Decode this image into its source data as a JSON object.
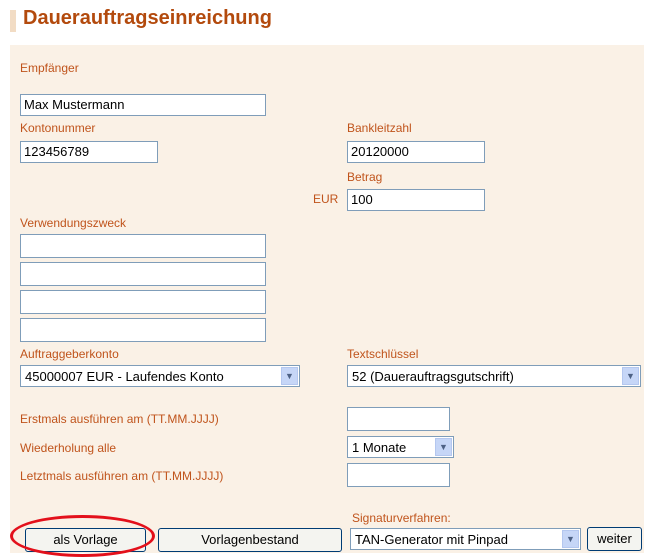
{
  "page": {
    "title": "Dauerauftragseinreichung"
  },
  "form": {
    "empfaenger": {
      "label": "Empfänger",
      "value": "Max Mustermann"
    },
    "kontonummer": {
      "label": "Kontonummer",
      "value": "123456789"
    },
    "bankleitzahl": {
      "label": "Bankleitzahl",
      "value": "20120000"
    },
    "betrag": {
      "label": "Betrag",
      "currency": "EUR",
      "value": "100"
    },
    "verwendungszweck": {
      "label": "Verwendungszweck",
      "lines": [
        "",
        "",
        "",
        ""
      ]
    },
    "auftraggeberkonto": {
      "label": "Auftraggeberkonto",
      "selected": "45000007 EUR - Laufendes Konto"
    },
    "textschluessel": {
      "label": "Textschlüssel",
      "selected": "52 (Dauerauftragsgutschrift)"
    },
    "erstmals": {
      "label": "Erstmals ausführen am (TT.MM.JJJJ)",
      "value": ""
    },
    "wiederholung": {
      "label": "Wiederholung alle",
      "selected": "1 Monate"
    },
    "letztmals": {
      "label": "Letztmals ausführen am (TT.MM.JJJJ)",
      "value": ""
    },
    "signaturverfahren": {
      "label": "Signaturverfahren:",
      "selected": "TAN-Generator mit Pinpad"
    }
  },
  "buttons": {
    "als_vorlage": "als Vorlage",
    "vorlagenbestand": "Vorlagenbestand",
    "weiter": "weiter"
  },
  "colors": {
    "title": "#b34a0d",
    "label": "#c0541c",
    "panel_bg": "#faf1e6",
    "highlight": "#e3101b"
  }
}
